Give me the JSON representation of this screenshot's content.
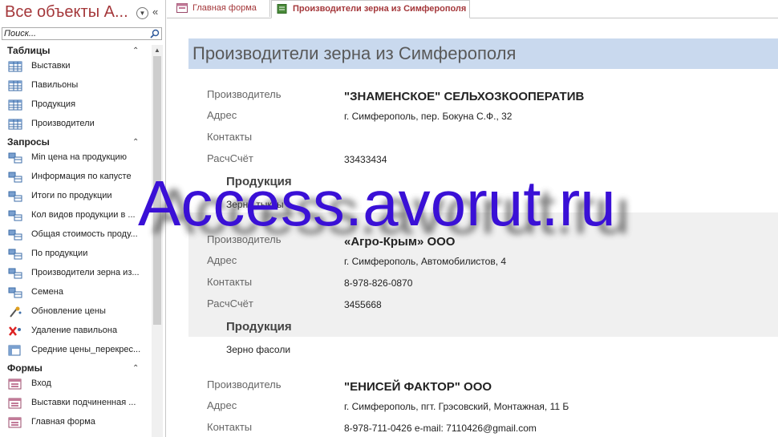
{
  "nav": {
    "title": "Все объекты А...",
    "search_placeholder": "Поиск...",
    "groups": [
      {
        "label": "Таблицы",
        "items": [
          {
            "label": "Выставки",
            "icon": "table-icon"
          },
          {
            "label": "Павильоны",
            "icon": "table-icon"
          },
          {
            "label": "Продукция",
            "icon": "table-icon"
          },
          {
            "label": "Производители",
            "icon": "table-icon"
          }
        ]
      },
      {
        "label": "Запросы",
        "items": [
          {
            "label": "Min цена на продукцию",
            "icon": "query-icon"
          },
          {
            "label": "Информация по капусте",
            "icon": "query-icon"
          },
          {
            "label": "Итоги по продукции",
            "icon": "query-icon"
          },
          {
            "label": "Кол видов продукции в ...",
            "icon": "query-icon"
          },
          {
            "label": "Общая стоимость проду...",
            "icon": "query-icon"
          },
          {
            "label": "По продукции",
            "icon": "query-icon"
          },
          {
            "label": "Производители зерна из...",
            "icon": "query-icon"
          },
          {
            "label": "Семена",
            "icon": "query-icon"
          },
          {
            "label": "Обновление цены",
            "icon": "update-query-icon"
          },
          {
            "label": "Удаление павильона",
            "icon": "delete-query-icon"
          },
          {
            "label": "Средние цены_перекрес...",
            "icon": "crosstab-query-icon"
          }
        ]
      },
      {
        "label": "Формы",
        "items": [
          {
            "label": "Вход",
            "icon": "form-icon"
          },
          {
            "label": "Выставки подчиненная ...",
            "icon": "form-icon"
          },
          {
            "label": "Главная форма",
            "icon": "form-icon"
          }
        ]
      }
    ]
  },
  "tabs": [
    {
      "label": "Главная форма",
      "icon": "form-icon"
    },
    {
      "label": "Производители зерна из Симферополя",
      "icon": "report-icon"
    }
  ],
  "report": {
    "title": "Производители зерна из Симферополя",
    "labels": {
      "producer": "Производитель",
      "address": "Адрес",
      "contacts": "Контакты",
      "account": "РасчСчёт",
      "products": "Продукция"
    },
    "records": [
      {
        "name": "\"ЗНАМЕНСКОЕ\" СЕЛЬХОЗКООПЕРАТИВ",
        "address": "г. Симферополь, пер. Бокуна С.Ф., 32",
        "contacts": "",
        "account": "33433434",
        "product": "Зерно тыквы"
      },
      {
        "name": "«Агро-Крым» ООО",
        "address": "г. Симферополь, Автомобилистов, 4",
        "contacts": "8-978-826-0870",
        "account": "3455668",
        "product": "Зерно фасоли"
      },
      {
        "name": "\"ЕНИСЕЙ ФАКТОР\" ООО",
        "address": "г. Симферополь, пгт. Грэсовский, Монтажная, 11 Б",
        "contacts": "8-978-711-0426 e-mail: 7110426@gmail.com",
        "account": "",
        "product": ""
      }
    ]
  },
  "watermark": "Access.avorut.ru",
  "colors": {
    "accent": "#a4373a",
    "header_band": "#c9d9ee",
    "watermark": "#3a10d6"
  }
}
